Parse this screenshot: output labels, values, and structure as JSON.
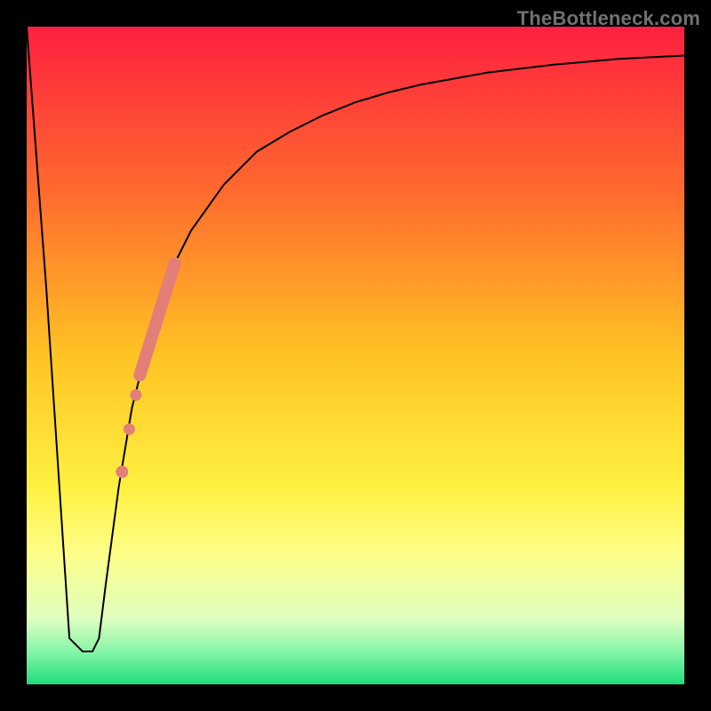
{
  "watermark": {
    "text": "TheBottleneck.com"
  },
  "chart_data": {
    "type": "line",
    "title": "",
    "xlabel": "",
    "ylabel": "",
    "xlim": [
      0,
      100
    ],
    "ylim": [
      0,
      100
    ],
    "grid": false,
    "legend": false,
    "background_gradient": {
      "stops": [
        {
          "pos": 0.0,
          "color": "#ff2040"
        },
        {
          "pos": 0.25,
          "color": "#ff6a2e"
        },
        {
          "pos": 0.5,
          "color": "#ffc324"
        },
        {
          "pos": 0.7,
          "color": "#fff141"
        },
        {
          "pos": 0.8,
          "color": "#fdfe87"
        },
        {
          "pos": 0.9,
          "color": "#dffec0"
        },
        {
          "pos": 0.95,
          "color": "#86f6a8"
        },
        {
          "pos": 1.0,
          "color": "#1edc7a"
        }
      ]
    },
    "series": [
      {
        "name": "bottleneck-curve",
        "color": "#000000",
        "stroke_width": 2,
        "x": [
          0,
          3,
          6.5,
          8.5,
          10,
          11,
          12,
          14,
          16,
          18,
          20,
          22,
          25,
          30,
          35,
          40,
          45,
          50,
          55,
          60,
          70,
          80,
          90,
          100
        ],
        "values": [
          100,
          60,
          7,
          5,
          5,
          7,
          15,
          30,
          42,
          50,
          57,
          63,
          69,
          76,
          81,
          84,
          86.5,
          88.5,
          90,
          91.2,
          93,
          94.2,
          95.1,
          95.6
        ]
      }
    ],
    "highlight_segments": [
      {
        "name": "highlight-bar",
        "color": "#e37f78",
        "stroke_width": 14,
        "linecap": "round",
        "x": [
          17.2,
          22.5
        ],
        "values": [
          47,
          64
        ]
      }
    ],
    "highlight_points": [
      {
        "x": 16.6,
        "y": 44.0,
        "r": 6.5,
        "color": "#e37f78"
      },
      {
        "x": 15.6,
        "y": 38.8,
        "r": 6.5,
        "color": "#e37f78"
      },
      {
        "x": 14.5,
        "y": 32.3,
        "r": 7.0,
        "color": "#e37f78"
      }
    ]
  }
}
